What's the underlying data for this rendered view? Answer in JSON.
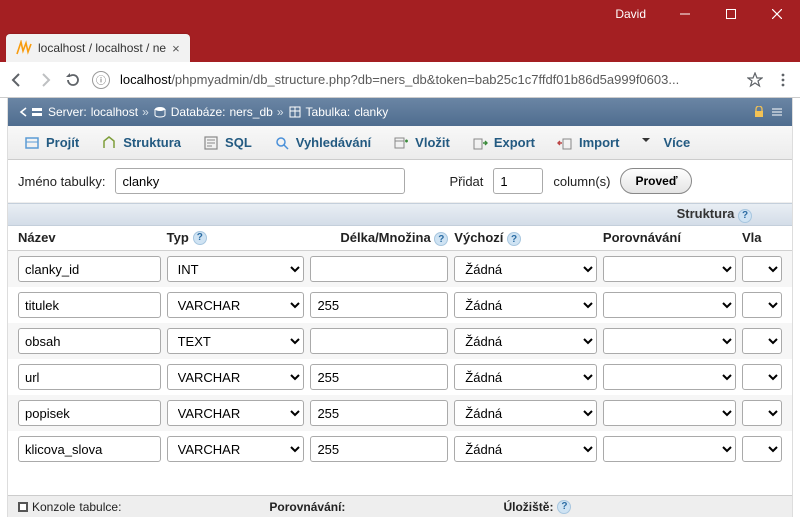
{
  "window": {
    "user": "David"
  },
  "browser_tab": {
    "title": "localhost / localhost / ne"
  },
  "address": {
    "host": "localhost",
    "path": "/phpmyadmin/db_structure.php?db=ners_db&token=bab25c1c7ffdf01b86d5a999f0603..."
  },
  "breadcrumb": {
    "server_label": "Server:",
    "server_value": "localhost",
    "db_label": "Databáze:",
    "db_value": "ners_db",
    "table_label": "Tabulka:",
    "table_value": "clanky"
  },
  "tabs": {
    "browse": "Projít",
    "structure": "Struktura",
    "sql": "SQL",
    "search": "Vyhledávání",
    "insert": "Vložit",
    "export": "Export",
    "import": "Import",
    "more": "Více"
  },
  "toolbar": {
    "table_name_label": "Jméno tabulky:",
    "table_name_value": "clanky",
    "add_label": "Přidat",
    "add_count": "1",
    "columns_label": "column(s)",
    "go": "Proveď"
  },
  "section": {
    "structure": "Struktura"
  },
  "headers": {
    "name": "Název",
    "type": "Typ",
    "length": "Délka/Množina",
    "default": "Výchozí",
    "collation": "Porovnávání",
    "attributes": "Vla"
  },
  "defaults_option": "Žádná",
  "rows": [
    {
      "name": "clanky_id",
      "type": "INT",
      "length": "",
      "def": "Žádná"
    },
    {
      "name": "titulek",
      "type": "VARCHAR",
      "length": "255",
      "def": "Žádná"
    },
    {
      "name": "obsah",
      "type": "TEXT",
      "length": "",
      "def": "Žádná"
    },
    {
      "name": "url",
      "type": "VARCHAR",
      "length": "255",
      "def": "Žádná"
    },
    {
      "name": "popisek",
      "type": "VARCHAR",
      "length": "255",
      "def": "Žádná"
    },
    {
      "name": "klicova_slova",
      "type": "VARCHAR",
      "length": "255",
      "def": "Žádná"
    }
  ],
  "footer": {
    "console": "Konzole",
    "table_suffix": "tabulce:",
    "collation": "Porovnávání:",
    "storage": "Úložiště:"
  }
}
